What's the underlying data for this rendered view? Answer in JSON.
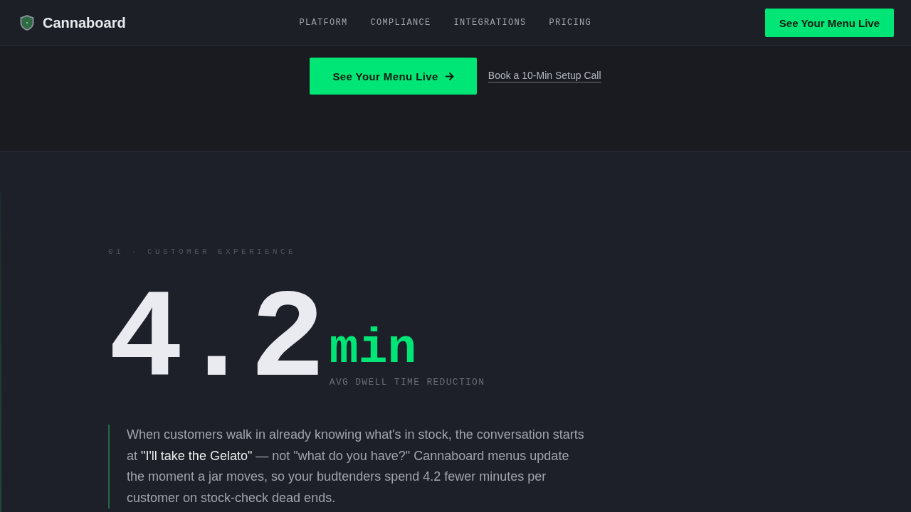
{
  "nav": {
    "logo": "Cannaboard",
    "links": [
      "PLATFORM",
      "COMPLIANCE",
      "INTEGRATIONS",
      "PRICING"
    ],
    "cta": "See Your Menu Live"
  },
  "hero": {
    "primary_button": "See Your Menu Live",
    "secondary_link": "Book a 10-Min Setup Call"
  },
  "stat_section": {
    "eyebrow": "01 · CUSTOMER EXPERIENCE",
    "value": "4.2",
    "unit": "min",
    "caption": "AVG DWELL TIME REDUCTION",
    "body": [
      {
        "text": "When customers walk in already knowing what's in stock, the conversation starts at ",
        "highlight": false
      },
      {
        "text": "\"I'll take the Gelato\"",
        "highlight": true
      },
      {
        "text": " — not \"what do you have?\" Cannaboard menus update the moment a jar moves, so your budtenders spend 4.2 fewer minutes per customer on stock-check dead ends.",
        "highlight": false
      }
    ]
  }
}
